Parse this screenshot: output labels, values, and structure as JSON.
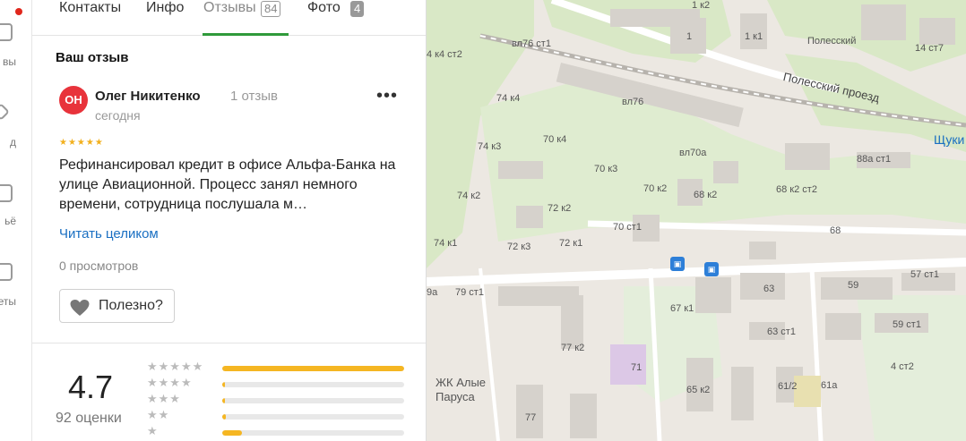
{
  "rail": {
    "items": [
      {
        "label": "вы",
        "icon": "user-icon"
      },
      {
        "label": "д",
        "icon": "pin-icon"
      },
      {
        "label": "ьё",
        "icon": "home-icon"
      },
      {
        "label": "еты",
        "icon": "thumb-icon"
      }
    ]
  },
  "tabs": [
    {
      "label": "Контакты"
    },
    {
      "label": "Инфо"
    },
    {
      "label": "Отзывы",
      "badge": "84",
      "active": true
    },
    {
      "label": "Фото",
      "badge": "4"
    }
  ],
  "review_section": {
    "title": "Ваш отзыв",
    "author_initials": "ОН",
    "author": "Олег Никитенко",
    "author_review_count": "1 отзыв",
    "date": "сегодня",
    "rating_stars": 5,
    "more_menu_label": "•••",
    "text": "Рефинансировал кредит в офисе Альфа-Банка на улице Авиационной. Процесс занял немного времени, сотрудница послушала м…",
    "read_more": "Читать целиком",
    "views": "0 просмотров",
    "useful_button": "Полезно?"
  },
  "rating_summary": {
    "score": "4.7",
    "count_label": "92 оценки",
    "distribution": [
      {
        "stars": "★★★★★",
        "share": 1.0
      },
      {
        "stars": "★★★★",
        "share": 0.01
      },
      {
        "stars": "★★★",
        "share": 0.01
      },
      {
        "stars": "★★",
        "share": 0.02
      },
      {
        "stars": "★",
        "share": 0.11
      }
    ]
  },
  "map": {
    "labels": [
      "вл76 ст1",
      "4 к4 ст2",
      "1",
      "1 к1",
      "Полесский",
      "14 ст7",
      "74 к4",
      "вл76",
      "70 к4",
      "74 к3",
      "70 к3",
      "вл70а",
      "88а ст1",
      "74 к2",
      "72 к2",
      "70 к2",
      "68 к2",
      "68 к2 ст2",
      "74 к1",
      "72 к3",
      "72 к1",
      "70 ст1",
      "68",
      "57 ст1",
      "79 ст1",
      "67 к1",
      "63",
      "59",
      "9а",
      "63 ст1",
      "59 ст1",
      "77 к2",
      "71",
      "4 ст2",
      "65 к2",
      "61/2",
      "61а",
      "77",
      "1 к2"
    ],
    "road_name": "Полесский проезд",
    "place_name": "ЖК Алые Паруса",
    "metro_name": "Щуки",
    "colors": {
      "park": "#d9e8c6",
      "road": "#ffffff",
      "building": "#d6d2cc",
      "rail": "#b7b3ad",
      "bus": "#2d7fd8"
    }
  }
}
